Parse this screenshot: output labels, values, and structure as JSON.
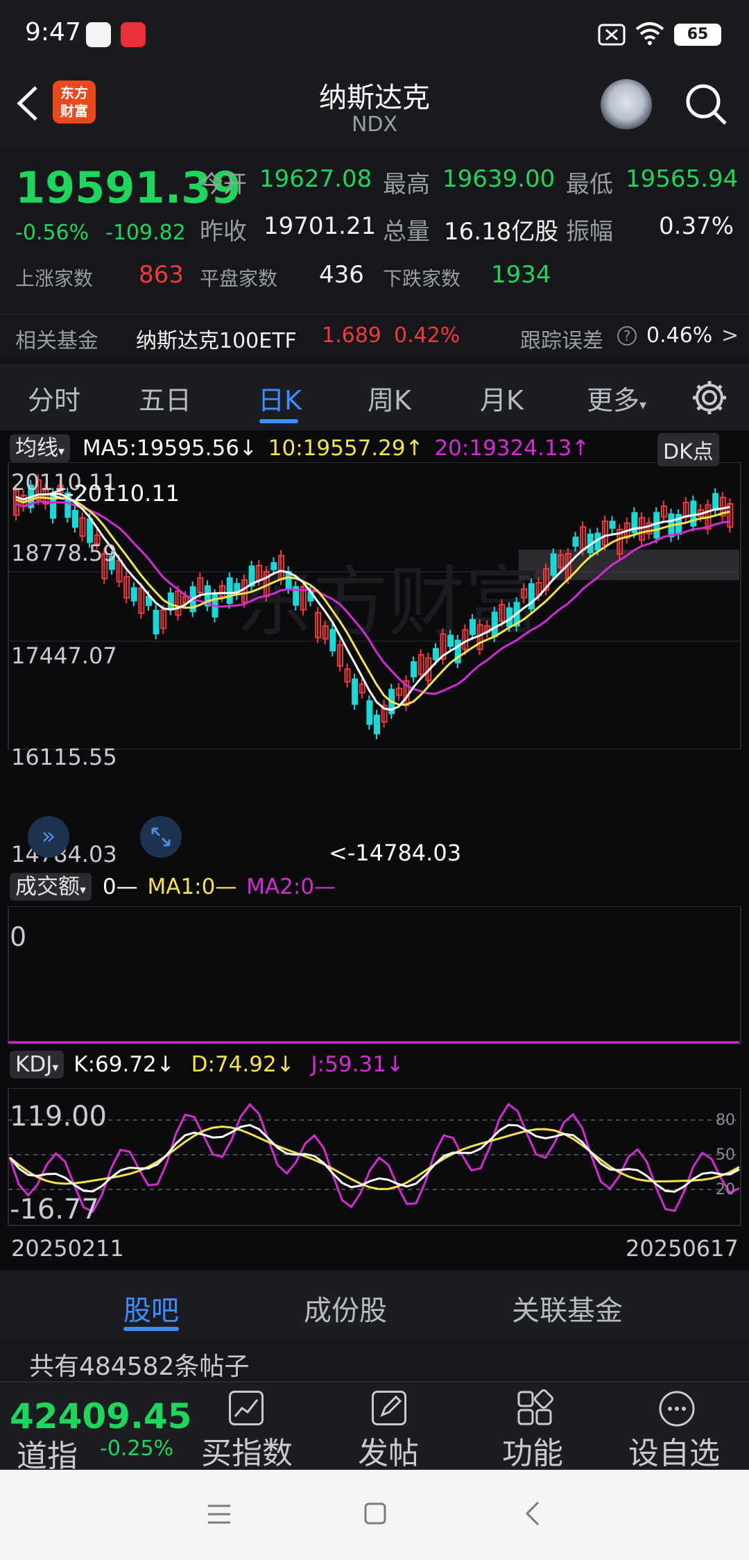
{
  "status": {
    "time": "9:47",
    "battery": "65"
  },
  "nav": {
    "title": "纳斯达克",
    "subtitle": "NDX",
    "logo_text": "东方财富"
  },
  "quote": {
    "price": "19591.39",
    "change_pct": "-0.56%",
    "change_abs": "-109.82",
    "open_label": "今开",
    "open": "19627.08",
    "high_label": "最高",
    "high": "19639.00",
    "low_label": "最低",
    "low": "19565.94",
    "prev_label": "昨收",
    "prev": "19701.21",
    "vol_label": "总量",
    "vol": "16.18亿股",
    "amp_label": "振幅",
    "amp": "0.37%",
    "up_label": "上涨家数",
    "up": "863",
    "flat_label": "平盘家数",
    "flat": "436",
    "down_label": "下跌家数",
    "down": "1934"
  },
  "fund": {
    "label": "相关基金",
    "name": "纳斯达克100ETF",
    "price": "1.689",
    "pct": "0.42%",
    "tracking_label": "跟踪误差",
    "tracking": "0.46%",
    "arrow": ">"
  },
  "tabs": [
    "分时",
    "五日",
    "日K",
    "周K",
    "月K",
    "更多"
  ],
  "kchart": {
    "ma_button": "均线",
    "ma5": "MA5:19595.56",
    "ma10": "10:19557.29",
    "ma20": "20:19324.13",
    "dk_button": "DK点",
    "y_labels": [
      "20110.11",
      "18778.59",
      "17447.07",
      "16115.55",
      "14784.03"
    ],
    "high_mark": "<-20110.11",
    "low_mark": "<-14784.03",
    "colors": {
      "up": "#f23a3a",
      "down": "#19d8d8",
      "ma5": "#ffffff",
      "ma10": "#f5e54a",
      "ma20": "#d42bd4"
    }
  },
  "volume": {
    "button": "成交额",
    "v0": "0",
    "ma1": "MA1:0",
    "ma2": "MA2:0",
    "axis0": "0"
  },
  "kdj": {
    "button": "KDJ",
    "k": "K:69.72",
    "d": "D:74.92",
    "j": "J:59.31",
    "top": "119.00",
    "bottom": "-16.77",
    "levels": [
      "80",
      "50",
      "20"
    ],
    "date_start": "20250211",
    "date_end": "20250617"
  },
  "bartabs": [
    "股吧",
    "成份股",
    "关联基金"
  ],
  "posts": {
    "text": "共有484582条帖子"
  },
  "bottom": {
    "index_value": "42409.45",
    "index_name": "道指",
    "index_pct": "-0.25%",
    "items": [
      "买指数",
      "发帖",
      "功能",
      "设自选"
    ]
  }
}
